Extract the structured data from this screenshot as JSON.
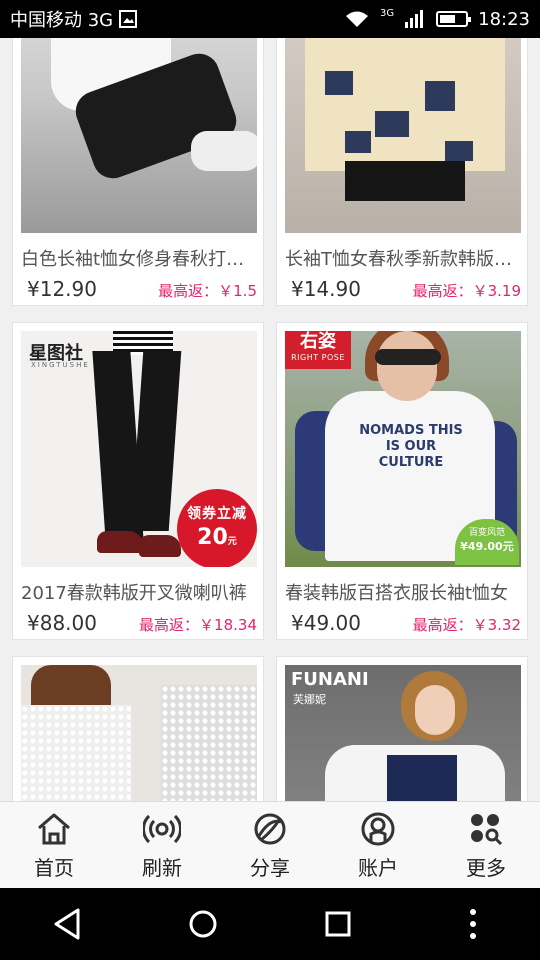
{
  "status_bar": {
    "carrier": "中国移动 3G",
    "network_small": "3G",
    "time": "18:23",
    "battery_level": 0.6
  },
  "products": [
    {
      "title": "白色长袖t恤女修身春秋打底衫",
      "price": "¥12.90",
      "rebate": "最高返：￥1.5"
    },
    {
      "title": "长袖T恤女春秋季新款韩版印花",
      "price": "¥14.90",
      "rebate": "最高返：￥3.19"
    },
    {
      "title": "2017春款韩版开叉微喇叭裤",
      "price": "¥88.00",
      "rebate": "最高返：￥18.34",
      "image": {
        "logo": "星图社",
        "logo_sub": "XINGTUSHE",
        "badge_line1": "领券立减",
        "badge_amount": "20",
        "badge_unit": "元"
      }
    },
    {
      "title": "春装韩版百搭衣服长袖t恤女",
      "price": "¥49.00",
      "rebate": "最高返：￥3.32",
      "image": {
        "brand": "右姿",
        "brand_en": "RIGHT POSE",
        "print": "NOMADS THIS IS OUR CULTURE",
        "badge_line1": "百变风范",
        "badge_price": "¥49.00元"
      }
    },
    {
      "title": "",
      "price": "",
      "rebate": ""
    },
    {
      "title": "",
      "price": "",
      "rebate": "",
      "image": {
        "brand": "FUNANI",
        "brand_cn": "芙娜妮"
      }
    }
  ],
  "tabs": [
    {
      "label": "首页",
      "icon": "home-icon"
    },
    {
      "label": "刷新",
      "icon": "refresh-icon"
    },
    {
      "label": "分享",
      "icon": "share-icon"
    },
    {
      "label": "账户",
      "icon": "account-icon"
    },
    {
      "label": "更多",
      "icon": "more-icon"
    }
  ],
  "colors": {
    "rebate": "#e6246e",
    "badge_red": "#d7182a",
    "badge_green": "#7dc242"
  }
}
